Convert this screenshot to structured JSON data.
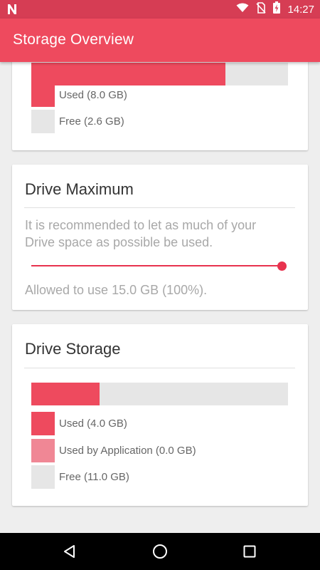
{
  "status_bar": {
    "time": "14:27",
    "icons": [
      "n-logo-icon",
      "wifi-icon",
      "no-sim-icon",
      "battery-icon"
    ]
  },
  "app_bar": {
    "title": "Storage Overview"
  },
  "colors": {
    "primary": "#ee4a5e",
    "primary_dark": "#d63d54",
    "app_usage": "#f08795",
    "free": "#e6e6e6",
    "slider": "#e8324e"
  },
  "device_storage_card": {
    "used_fraction": 0.755,
    "legend": [
      {
        "label": "Used (8.0 GB)",
        "swatch": "#ee4a5e"
      },
      {
        "label": "Free (2.6 GB)",
        "swatch": "#e6e6e6"
      }
    ]
  },
  "drive_maximum_card": {
    "title": "Drive Maximum",
    "description": "It is recommended to let as much of your Drive space as possible be used.",
    "slider_percent": 100,
    "allowed_text": "Allowed to use 15.0 GB (100%)."
  },
  "drive_storage_card": {
    "title": "Drive Storage",
    "used_fraction": 0.265,
    "legend": [
      {
        "label": "Used (4.0 GB)",
        "swatch": "#ee4a5e"
      },
      {
        "label": "Used by Application (0.0 GB)",
        "swatch": "#f08795"
      },
      {
        "label": "Free (11.0 GB)",
        "swatch": "#e6e6e6"
      }
    ]
  },
  "nav_bar": {
    "buttons": [
      "back-icon",
      "home-icon",
      "recents-icon"
    ]
  }
}
